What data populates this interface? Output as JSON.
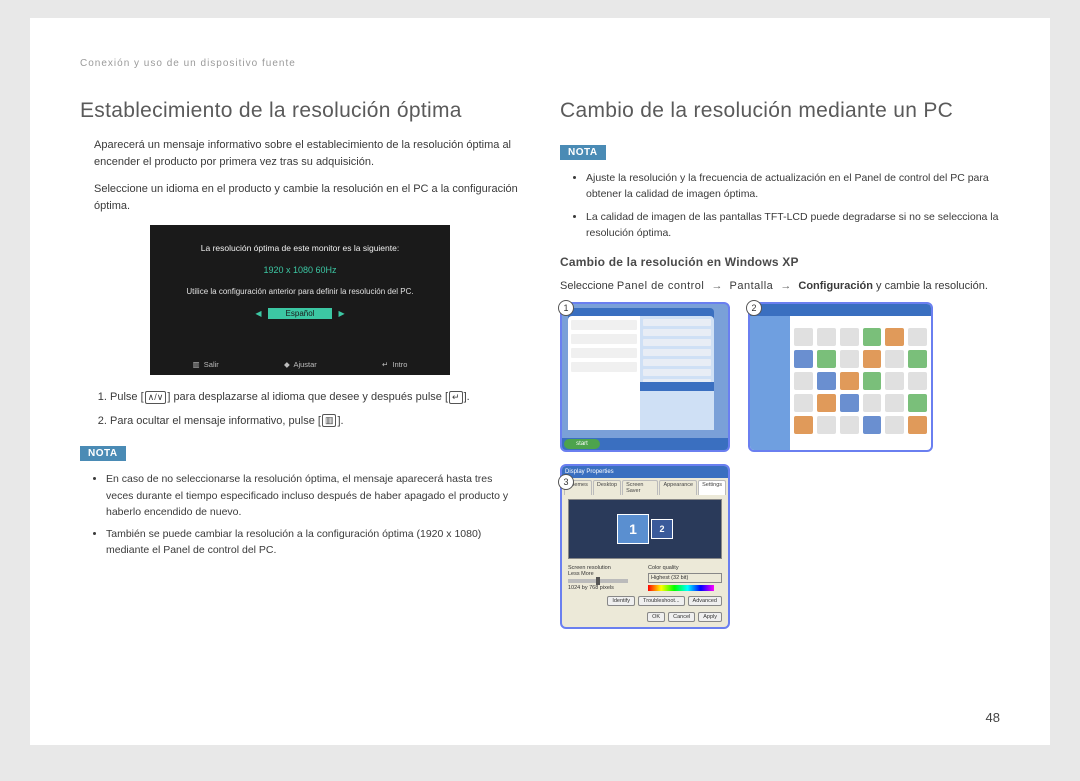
{
  "header_path": "Conexión y uso de un dispositivo fuente",
  "left": {
    "title": "Establecimiento de la resolución óptima",
    "p1": "Aparecerá un mensaje informativo sobre el establecimiento de la resolución óptima al encender el producto por primera vez tras su adquisición.",
    "p2": "Seleccione un idioma en el producto y cambie la resolución en el PC a la configuración óptima.",
    "osd": {
      "line1": "La resolución óptima de este monitor es la siguiente:",
      "res": "1920 x 1080 60Hz",
      "line2": "Utilice la configuración anterior para definir la resolución del PC.",
      "lang": "Español",
      "b1": "Salir",
      "b2": "Ajustar",
      "b3": "Intro"
    },
    "step1_a": "Pulse [",
    "step1_b": "] para desplazarse al idioma que desee y después pulse [",
    "step1_c": "].",
    "step2_a": "Para ocultar el mensaje informativo, pulse [",
    "step2_b": "].",
    "note_label": "NOTA",
    "note_b1": "En caso de no seleccionarse la resolución óptima, el mensaje aparecerá hasta tres veces durante el tiempo especificado incluso después de haber apagado el producto y haberlo encendido de nuevo.",
    "note_b2": "También se puede cambiar la resolución a la configuración óptima (1920 x 1080) mediante el Panel de control del PC."
  },
  "right": {
    "title": "Cambio de la resolución mediante un PC",
    "note_label": "NOTA",
    "note_b1": "Ajuste la resolución y la frecuencia de actualización en el Panel de control del PC para obtener la calidad de imagen óptima.",
    "note_b2": "La calidad de imagen de las pantallas TFT-LCD puede degradarse si no se selecciona la resolución óptima.",
    "sub_title": "Cambio de la resolución en Windows XP",
    "instr_a": "Seleccione ",
    "instr_panel": "Panel de control",
    "instr_pantalla": "Pantalla",
    "instr_config": "Configuración",
    "instr_tail": " y cambie la resolución.",
    "shot1": {
      "start": "start"
    },
    "shot3": {
      "title": "Display Properties",
      "tab1": "Themes",
      "tab2": "Desktop",
      "tab3": "Screen Saver",
      "tab4": "Appearance",
      "tab5": "Settings",
      "mon1": "1",
      "mon2": "2",
      "res_label": "Screen resolution",
      "res_text": "Less       More",
      "res_value": "1024 by 768 pixels",
      "cq_label": "Color quality",
      "cq_value": "Highest (32 bit)",
      "btn_id": "Identify",
      "btn_trb": "Troubleshoot...",
      "btn_adv": "Advanced",
      "btn_ok": "OK",
      "btn_cancel": "Cancel",
      "btn_apply": "Apply"
    },
    "badge1": "1",
    "badge2": "2",
    "badge3": "3"
  },
  "page_number": "48"
}
